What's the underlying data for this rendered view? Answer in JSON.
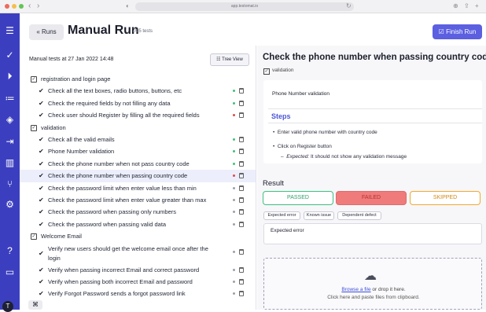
{
  "browser": {
    "url": "app.testomat.io"
  },
  "header": {
    "runs_label": "Runs",
    "title": "Manual Run",
    "count": "7/15 tests",
    "finish_label": "Finish Run"
  },
  "left": {
    "manual_label": "Manual tests at 27 Jan 2022 14:48",
    "tree_view_label": "Tree View",
    "rows": [
      {
        "kind": "suite",
        "text": "registration and login page"
      },
      {
        "kind": "test",
        "text": "Check all the text boxes, radio buttons, buttons, etc",
        "status": "passed"
      },
      {
        "kind": "test",
        "text": "Check the required fields by not filling any data",
        "status": "passed"
      },
      {
        "kind": "test",
        "text": "Check user should Register by filling all the required fields",
        "status": "failed"
      },
      {
        "kind": "suite",
        "text": "validation"
      },
      {
        "kind": "test",
        "text": "Check all the valid emails",
        "status": "passed"
      },
      {
        "kind": "test",
        "text": "Phone Number validation",
        "status": "passed"
      },
      {
        "kind": "test",
        "text": "Check the phone number when not pass country code",
        "status": "passed"
      },
      {
        "kind": "test",
        "text": "Check the phone number when passing country code",
        "status": "failed",
        "active": true
      },
      {
        "kind": "test",
        "text": "Check the password limit when enter value less than min",
        "status": "none"
      },
      {
        "kind": "test",
        "text": "Check the password limit when enter value greater than max",
        "status": "none"
      },
      {
        "kind": "test",
        "text": "Check the password when passing only numbers",
        "status": "none"
      },
      {
        "kind": "test",
        "text": "Check the password when passing valid data",
        "status": "none"
      },
      {
        "kind": "suite",
        "text": "Welcome Email"
      },
      {
        "kind": "test2",
        "text": "Verify new users should get the welcome email once after the",
        "text2": "login",
        "status": "none"
      },
      {
        "kind": "test",
        "text": "Verify when passing incorrect Email and correct password",
        "status": "none"
      },
      {
        "kind": "test",
        "text": "Verify when passing both incorrect Email and password",
        "status": "none"
      },
      {
        "kind": "test",
        "text": "Verify Forgot Password sends a forgot password link",
        "status": "none"
      }
    ]
  },
  "right": {
    "title": "Check the phone number when passing country code",
    "tag": "validation",
    "card_title": "Phone Number validation",
    "steps_heading": "Steps",
    "step1": "Enter valid phone number with country code",
    "step2": "Click on Register button",
    "expected_label": "Expected:",
    "expected_text": "It should not show any validation message",
    "result_heading": "Result",
    "passed_label": "PASSED",
    "failed_label": "FAILED",
    "skipped_label": "SKIPPED",
    "chips": [
      "Expected error",
      "Known issue",
      "Dependent defect"
    ],
    "result_text": "Expected error",
    "browse_link": "Browse a file",
    "browse_rest": "or drop it here.",
    "paste_text": "Click here and paste files from clipboard."
  },
  "colors": {
    "sidebar": "#3b3fbf",
    "accent": "#5b5fe0",
    "passed": "#3fbf7f",
    "failed": "#e04a4a",
    "skipped": "#f0a830"
  },
  "sidebar_icons": [
    "menu-icon",
    "check-icon",
    "play-icon",
    "checklist-icon",
    "layers-icon",
    "import-icon",
    "analytics-icon",
    "branch-icon",
    "settings-icon",
    "help-icon",
    "folder-icon"
  ]
}
